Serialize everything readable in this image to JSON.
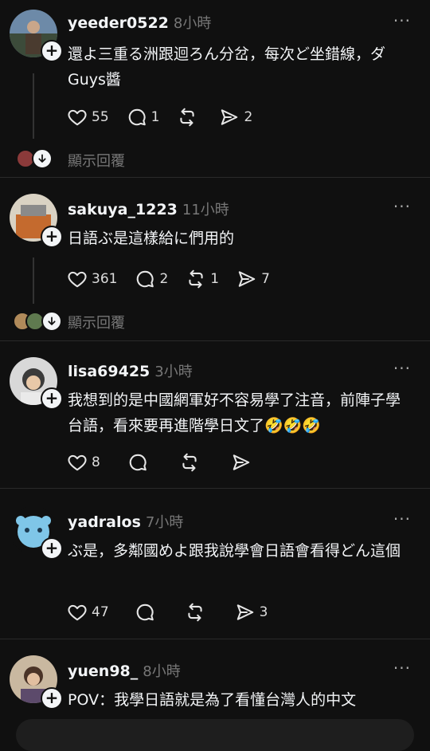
{
  "posts": [
    {
      "username": "yeeder0522",
      "time": "8小時",
      "text": "還よ三重る洲跟迴ろん分岔，每次ど坐錯線，ダGuys醬",
      "likes": "55",
      "comments": "1",
      "reposts": "",
      "shares": "2",
      "show_replies": "顯示回覆"
    },
    {
      "username": "sakuya_1223",
      "time": "11小時",
      "text": "日語ぶ是這樣給に們用的",
      "likes": "361",
      "comments": "2",
      "reposts": "1",
      "shares": "7",
      "show_replies": "顯示回覆"
    },
    {
      "username": "lisa69425",
      "time": "3小時",
      "text": "我想到的是中國網軍好不容易學了注音，前陣子學台語，看來要再進階學日文了🤣🤣🤣",
      "likes": "8",
      "comments": "",
      "reposts": "",
      "shares": ""
    },
    {
      "username": "yadralos",
      "time": "7小時",
      "text": "ぶ是，多鄰國めよ跟我說學會日語會看得どん這個",
      "likes": "47",
      "comments": "",
      "reposts": "",
      "shares": "3"
    },
    {
      "username": "yuen98_",
      "time": "8小時",
      "text": "POV：我學日語就是為了看懂台灣人的中文"
    }
  ],
  "icons": {
    "like": "heart-icon",
    "comment": "comment-bubble-icon",
    "repost": "repost-icon",
    "share": "send-icon",
    "more": "more-dots-icon",
    "follow": "plus-icon",
    "expand": "arrow-down-icon"
  },
  "colors": {
    "background": "#101010",
    "text": "#f3f5f7",
    "muted": "#777777",
    "divider": "#2a2a2a"
  }
}
